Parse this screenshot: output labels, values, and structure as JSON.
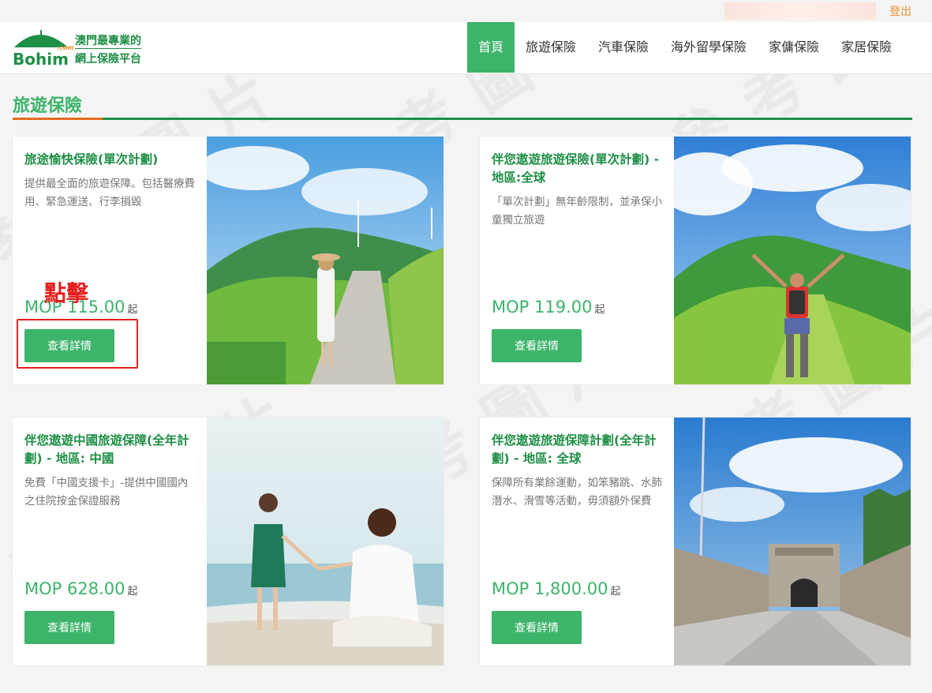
{
  "topbar": {
    "logout_label": "登出"
  },
  "logo": {
    "wordmark": "Bohim",
    "dotcom": ".com",
    "slogan_line1": "澳門最專業的",
    "slogan_line2": "網上保險平台"
  },
  "nav": {
    "items": [
      {
        "label": "首頁",
        "active": true
      },
      {
        "label": "旅遊保險",
        "active": false
      },
      {
        "label": "汽車保險",
        "active": false
      },
      {
        "label": "海外留學保險",
        "active": false
      },
      {
        "label": "家傭保險",
        "active": false
      },
      {
        "label": "家居保險",
        "active": false
      }
    ]
  },
  "section": {
    "title": "旅遊保險"
  },
  "cards": [
    {
      "title": "旅途愉快保險(單次計劃)",
      "desc": "提供最全面的旅遊保障。包括醫療費用、緊急運送、行李損毀",
      "price": "MOP 115.00",
      "price_unit": "起",
      "button": "查看詳情"
    },
    {
      "title": "伴您遨遊旅遊保險(單次計劃) - 地區:全球",
      "desc": "「單次計劃」無年齡限制，並承保小童獨立旅遊",
      "price": "MOP 119.00",
      "price_unit": "起",
      "button": "查看詳情"
    },
    {
      "title": "伴您遨遊中國旅遊保障(全年計劃) - 地區: 中國",
      "desc": "免費「中國支援卡」-提供中國國內之住院按金保證服務",
      "price": "MOP 628.00",
      "price_unit": "起",
      "button": "查看詳情"
    },
    {
      "title": "伴您遨遊旅遊保障計劃(全年計劃) - 地區: 全球",
      "desc": "保障所有業餘運動，如笨豬跳、水肺潛水、滑雪等活動，毋須額外保費",
      "price": "MOP 1,800.00",
      "price_unit": "起",
      "button": "查看詳情"
    }
  ],
  "annotation": {
    "text": "點擊"
  },
  "watermark": {
    "text": "參考圖片"
  },
  "colors": {
    "brand_green": "#3cb46a",
    "dark_green": "#1e8f45",
    "accent_orange": "#e36c1f",
    "annotation_red": "#e61e1e"
  }
}
